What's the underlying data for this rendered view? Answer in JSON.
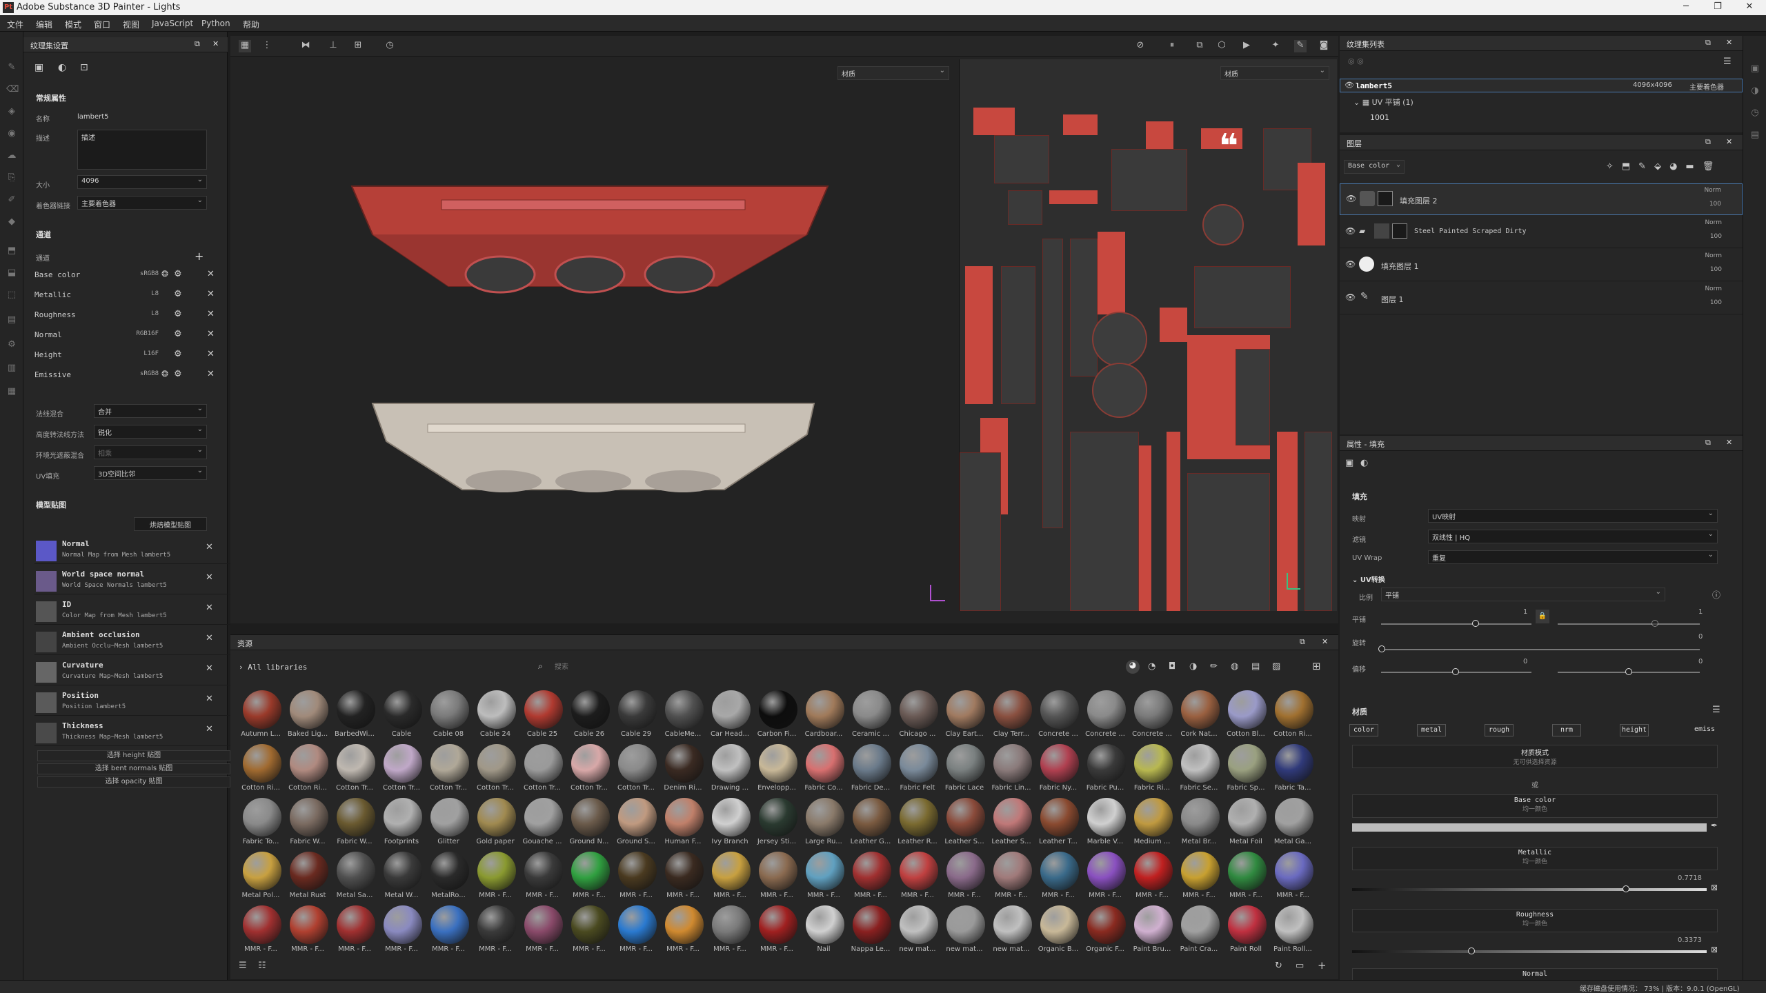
{
  "window": {
    "title": "Adobe Substance 3D Painter - Lights",
    "icon": "Pt"
  },
  "menu": [
    "文件",
    "编辑",
    "模式",
    "窗口",
    "视图",
    "JavaScript",
    "Python",
    "帮助"
  ],
  "texset_panel": {
    "title": "纹理集设置",
    "general_title": "常规属性",
    "name_label": "名称",
    "name_value": "lambert5",
    "desc_label": "描述",
    "desc_value": "描述",
    "size_label": "大小",
    "size_value": "4096",
    "shader_label": "着色器链接",
    "shader_value": "主要着色器",
    "channels_title": "通道",
    "channels_label": "通道",
    "channels": [
      {
        "name": "Base color",
        "fmt": "sRGB8"
      },
      {
        "name": "Metallic",
        "fmt": "L8"
      },
      {
        "name": "Roughness",
        "fmt": "L8"
      },
      {
        "name": "Normal",
        "fmt": "RGB16F"
      },
      {
        "name": "Height",
        "fmt": "L16F"
      },
      {
        "name": "Emissive",
        "fmt": "sRGB8"
      }
    ],
    "normal_mix_label": "法线混合",
    "normal_mix_value": "合并",
    "height_label": "高度转法线方法",
    "height_value": "锐化",
    "ao_label": "环境光遮蔽混合",
    "ao_value": "相乘",
    "uv_label": "UV填充",
    "uv_value": "3D空间比邻",
    "mesh_maps_title": "模型贴图",
    "bake_button": "烘焙模型贴图",
    "mesh_maps": [
      {
        "title": "Normal",
        "sub": "Normal Map from Mesh lambert5"
      },
      {
        "title": "World space normal",
        "sub": "World Space Normals lambert5"
      },
      {
        "title": "ID",
        "sub": "Color Map from Mesh lambert5"
      },
      {
        "title": "Ambient occlusion",
        "sub": "Ambient Occlu~Mesh lambert5"
      },
      {
        "title": "Curvature",
        "sub": "Curvature Map~Mesh lambert5"
      },
      {
        "title": "Position",
        "sub": "Position lambert5"
      },
      {
        "title": "Thickness",
        "sub": "Thickness Map~Mesh lambert5"
      }
    ],
    "select_buttons": [
      "选择 height 贴图",
      "选择 bent normals 贴图",
      "选择 opacity 贴图"
    ]
  },
  "viewport": {
    "material_dropdown": "材质",
    "uv_material_dropdown": "材质"
  },
  "assets": {
    "title": "资源",
    "libraries": "All libraries",
    "search_placeholder": "搜索",
    "rows": [
      [
        "Autumn L...",
        "Baked Lig...",
        "BarbedWi...",
        "Cable",
        "Cable 08",
        "Cable 24",
        "Cable 25",
        "Cable 26",
        "Cable 29",
        "CableMe...",
        "Car Head...",
        "Carbon Fi...",
        "Cardboar...",
        "Ceramic ...",
        "Chicago ...",
        "Clay Eart...",
        "Clay Terr...",
        "Concrete ...",
        "Concrete ...",
        "Concrete ...",
        "Cork Nat...",
        "Cotton Bl...",
        "Cotton Ri..."
      ],
      [
        "Cotton Ri...",
        "Cotton Ri...",
        "Cotton Tr...",
        "Cotton Tr...",
        "Cotton Tr...",
        "Cotton Tr...",
        "Cotton Tr...",
        "Cotton Tr...",
        "Cotton Tr...",
        "Denim Ri...",
        "Drawing ...",
        "Envelopp...",
        "Fabric Co...",
        "Fabric De...",
        "Fabric Felt",
        "Fabric Lace",
        "Fabric Lin...",
        "Fabric Ny...",
        "Fabric Pu...",
        "Fabric Ri...",
        "Fabric Se...",
        "Fabric Sp...",
        "Fabric Ta..."
      ],
      [
        "Fabric To...",
        "Fabric W...",
        "Fabric W...",
        "Footprints",
        "Glitter",
        "Gold paper",
        "Gouache ...",
        "Ground N...",
        "Ground S...",
        "Human F...",
        "Ivy Branch",
        "Jersey Sti...",
        "Large Ru...",
        "Leather G...",
        "Leather R...",
        "Leather S...",
        "Leather S...",
        "Leather T...",
        "Marble V...",
        "Medium ...",
        "Metal Br...",
        "Metal Foil",
        "Metal Ga..."
      ],
      [
        "Metal Pol...",
        "Metal Rust",
        "Metal Sa...",
        "Metal W...",
        "MetalRo...",
        "MMR - F...",
        "MMR - F...",
        "MMR - F...",
        "MMR - F...",
        "MMR - F...",
        "MMR - F...",
        "MMR - F...",
        "MMR - F...",
        "MMR - F...",
        "MMR - F...",
        "MMR - F...",
        "MMR - F...",
        "MMR - F...",
        "MMR - F...",
        "MMR - F...",
        "MMR - F...",
        "MMR - F...",
        "MMR - F..."
      ],
      [
        "MMR - F...",
        "MMR - F...",
        "MMR - F...",
        "MMR - F...",
        "MMR - F...",
        "MMR - F...",
        "MMR - F...",
        "MMR - F...",
        "MMR - F...",
        "MMR - F...",
        "MMR - F...",
        "MMR - F...",
        "Nail",
        "Nappa Le...",
        "new mat...",
        "new mat...",
        "new mat...",
        "Organic B...",
        "Organic F...",
        "Paint Bru...",
        "Paint Cra...",
        "Paint Roll",
        "Paint Roll..."
      ]
    ],
    "colors": [
      [
        "#9a3a2a",
        "#a08a7a",
        "#222222",
        "#2a2a2a",
        "#7a7a7a",
        "#bdbdbd",
        "#b03a30",
        "#1c1c1c",
        "#3a3a3a",
        "#505050",
        "#a8a8a8",
        "#0d0d0d",
        "#a07a5a",
        "#8a8a8a",
        "#6a5a55",
        "#a07a60",
        "#8a5040",
        "#555555",
        "#8a8a8a",
        "#7a7a7a",
        "#9a6040",
        "#9a9ac8",
        "#a07030"
      ],
      [
        "#a06a30",
        "#b08a80",
        "#bfb8b0",
        "#c0a8c8",
        "#b0a898",
        "#a09888",
        "#9a9a9a",
        "#d8a8a8",
        "#8a8a8a",
        "#3a2a22",
        "#c0c0c0",
        "#c8b898",
        "#d87070",
        "#6a7a8a",
        "#7a8a9a",
        "#7a8080",
        "#8a7a7a",
        "#b04050",
        "#3a3a3a",
        "#b8b850",
        "#c0c0c0",
        "#9aa080",
        "#303a7a"
      ],
      [
        "#8a8a8a",
        "#7a6a60",
        "#6a5a30",
        "#b0b0b0",
        "#a0a0a0",
        "#a08a50",
        "#a0a0a0",
        "#6a5a4a",
        "#c09a80",
        "#c0806a",
        "#d0d0d0",
        "#2a3a30",
        "#8a7a6a",
        "#7a5a40",
        "#7a6a30",
        "#8a4a3a",
        "#c07878",
        "#8a4a30",
        "#d0d0d0",
        "#c09a40",
        "#8a8a8a",
        "#b0b0b0",
        "#a0a0a0"
      ],
      [
        "#c8a040",
        "#6a2a20",
        "#505050",
        "#3a3a3a",
        "#2a2a2a",
        "#8a9a30",
        "#3a3a3a",
        "#30a040",
        "#4a3a20",
        "#3a2a20",
        "#c8a040",
        "#8a6a50",
        "#60a0c0",
        "#a03030",
        "#c04040",
        "#8a6a8a",
        "#a07a7a",
        "#3a6a8a",
        "#8a50c0",
        "#c02020",
        "#c8a030",
        "#308a40",
        "#6a6ac0"
      ],
      [
        "#a03030",
        "#b04030",
        "#a03030",
        "#8a8ac0",
        "#3a70c0",
        "#3a3a3a",
        "#8a4a6a",
        "#4a4a20",
        "#2a7ad0",
        "#d08a30",
        "#7a7a7a",
        "#a02020",
        "#d0d0d0",
        "#8a2020",
        "#c0c0c0",
        "#9a9a9a",
        "#c0c0c0",
        "#c8b898",
        "#8a2a20",
        "#d0b0d0",
        "#a0a0a0",
        "#c03040",
        "#c0c0c0"
      ]
    ]
  },
  "texlist": {
    "title": "纹理集列表",
    "set_name": "lambert5",
    "res": "4096x4096",
    "shader": "主要着色器",
    "uv": "UV 平铺 (1)",
    "tile": "1001"
  },
  "layers": {
    "title": "图层",
    "channel": "Base color",
    "items": [
      {
        "name": "填充图层 2",
        "blend": "Norm",
        "opacity": "100"
      },
      {
        "name": "Steel Painted Scraped Dirty",
        "blend": "Norm",
        "opacity": "100"
      },
      {
        "name": "填充图层 1",
        "blend": "Norm",
        "opacity": "100"
      },
      {
        "name": "图层 1",
        "blend": "Norm",
        "opacity": "100"
      }
    ]
  },
  "props": {
    "title": "属性 - 填充",
    "fill_title": "填充",
    "projection_label": "映射",
    "projection_value": "UV映射",
    "filter_label": "滤镜",
    "filter_value": "双线性 | HQ",
    "wrap_label": "UV Wrap",
    "wrap_value": "重复",
    "uvt_title": "UV转换",
    "scale_label": "比例",
    "scale_value": "平铺",
    "tile_label": "平铺",
    "tile_num": "1",
    "tile_num2": "1",
    "rot_label": "旋转",
    "rot_num": "0",
    "offset_label": "偏移",
    "offset_num": "0",
    "offset_num2": "0",
    "mat_title": "材质",
    "mat_buttons": [
      "color",
      "metal",
      "rough",
      "nrm",
      "height",
      "emiss"
    ],
    "mat_mode_title": "材质模式",
    "mat_mode_sub": "无可供选择资源",
    "or": "或",
    "base_title": "Base color",
    "base_sub": "均一颜色",
    "metal_title": "Metallic",
    "metal_sub": "均一颜色",
    "metal_value": "0.7718",
    "rough_title": "Roughness",
    "rough_sub": "均一颜色",
    "rough_value": "0.3373",
    "normal_title": "Normal"
  },
  "status": {
    "text": "缓存磁盘使用情况：  73%  | 版本：9.0.1 (OpenGL)"
  }
}
